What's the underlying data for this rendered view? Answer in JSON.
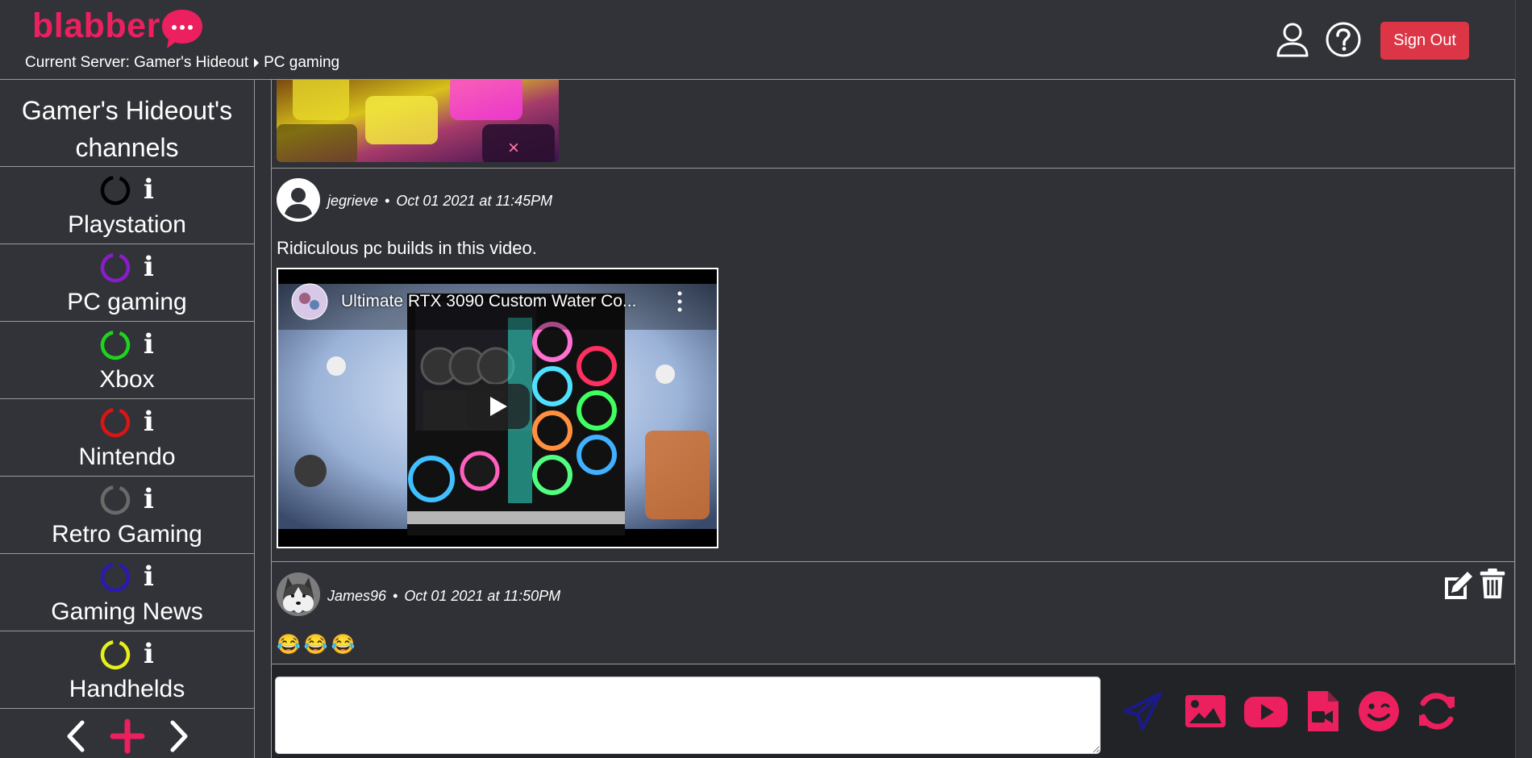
{
  "app": {
    "logo_text": "blabber"
  },
  "breadcrumb": {
    "prefix": "Current Server: Gamer's Hideout",
    "channel": "PC gaming"
  },
  "header": {
    "sign_out_label": "Sign Out",
    "icons": [
      "user-icon",
      "help-icon"
    ]
  },
  "sidebar": {
    "title": "Gamer's Hideout's channels",
    "channels": [
      {
        "name": "Playstation",
        "color": "#000000"
      },
      {
        "name": "PC gaming",
        "color": "#8a1ccc"
      },
      {
        "name": "Xbox",
        "color": "#1ed51e"
      },
      {
        "name": "Nintendo",
        "color": "#dd1414"
      },
      {
        "name": "Retro Gaming",
        "color": "#6a6a6a"
      },
      {
        "name": "Gaming News",
        "color": "#2a1ab4"
      },
      {
        "name": "Handhelds",
        "color": "#e6f01a"
      }
    ],
    "info_glyph": "i",
    "nav_icons": [
      "chevron-left-icon",
      "plus-icon",
      "chevron-right-icon"
    ]
  },
  "messages": [
    {
      "user": "jegrieve",
      "timestamp": "Oct 01 2021 at 11:45PM",
      "text": "Ridiculous pc builds in this video.",
      "video_title": "Ultimate RTX 3090 Custom Water Co..."
    },
    {
      "user": "James96",
      "timestamp": "Oct 01 2021 at 11:50PM",
      "text": "😂😂😂"
    }
  ],
  "separator": "•",
  "composer": {
    "placeholder": "",
    "tools": [
      "send-icon",
      "image-icon",
      "youtube-icon",
      "video-file-icon",
      "emoji-icon",
      "refresh-icon"
    ]
  },
  "colors": {
    "accent": "#ec1f5f",
    "signout": "#dc3545",
    "send": "#1a1a8c"
  }
}
